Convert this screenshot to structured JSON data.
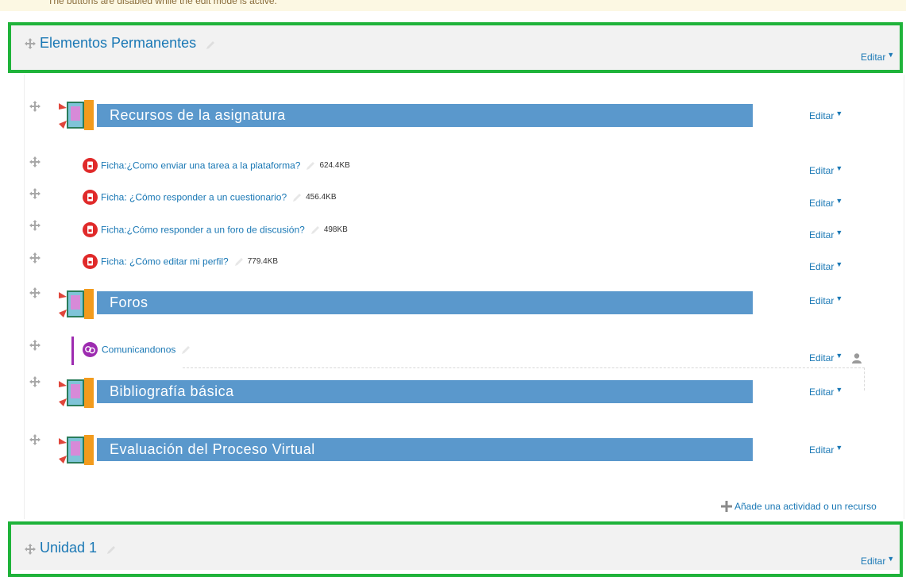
{
  "notice": {
    "text": "The buttons are disabled while the edit mode is active."
  },
  "colors": {
    "frame": "#1fb33a",
    "link": "#1a78b5",
    "bar": "#5a98cc",
    "pdf": "#e02a2a",
    "forum": "#9d2bb0"
  },
  "section0": {
    "title": "Elementos Permanentes",
    "edit_label": "Editar"
  },
  "labels": [
    {
      "text": "Recursos de la asignatura",
      "edit_label": "Editar"
    },
    {
      "text": "Foros",
      "edit_label": "Editar"
    },
    {
      "text": "Bibliografía básica",
      "edit_label": "Editar"
    },
    {
      "text": "Evaluación del Proceso Virtual",
      "edit_label": "Editar"
    }
  ],
  "resources": [
    {
      "name": "Ficha:¿Como enviar una tarea a la plataforma?",
      "size": "624.4KB",
      "icon": "pdf-icon",
      "edit_label": "Editar"
    },
    {
      "name": "Ficha: ¿Cómo responder a un cuestionario?",
      "size": "456.4KB",
      "icon": "pdf-icon",
      "edit_label": "Editar"
    },
    {
      "name": "Ficha:¿Cómo responder a un foro de discusión?",
      "size": "498KB",
      "icon": "pdf-icon",
      "edit_label": "Editar"
    },
    {
      "name": "Ficha: ¿Cómo editar mi perfil?",
      "size": "779.4KB",
      "icon": "pdf-icon",
      "edit_label": "Editar"
    }
  ],
  "forum": {
    "name": "Comunicandonos",
    "icon": "forum-icon",
    "edit_label": "Editar"
  },
  "add_activity": {
    "label": "Añade una actividad o un recurso"
  },
  "section1": {
    "title": "Unidad 1",
    "edit_label": "Editar"
  }
}
